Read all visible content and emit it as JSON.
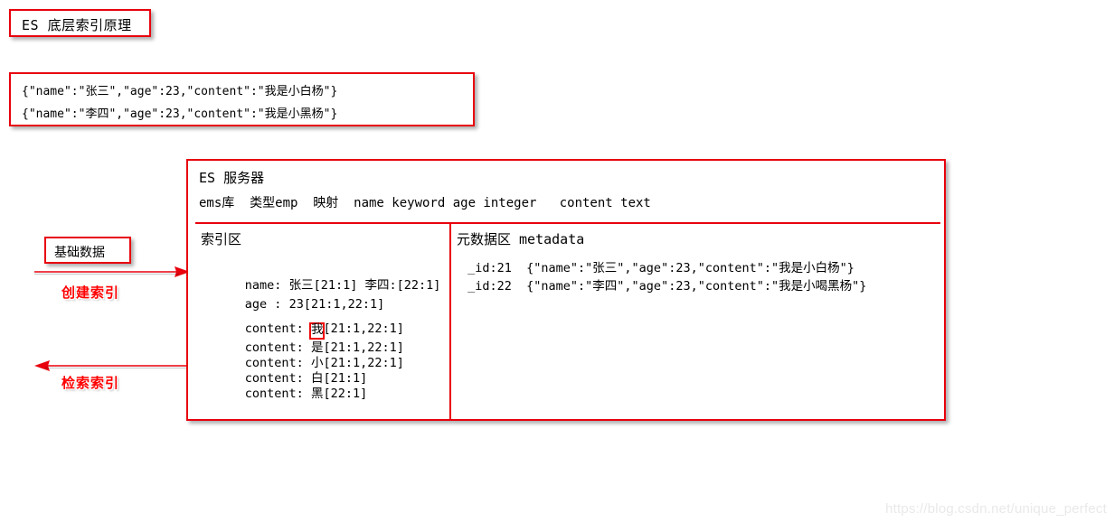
{
  "title": {
    "text": "ES 底层索引原理"
  },
  "source_documents": {
    "lines": [
      "{\"name\":\"张三\",\"age\":23,\"content\":\"我是小白杨\"}",
      "{\"name\":\"李四\",\"age\":23,\"content\":\"我是小黑杨\"}"
    ]
  },
  "annotations": {
    "base_data_label": "基础数据",
    "create_index_label": "创建索引",
    "search_index_label": "检索索引"
  },
  "es_server": {
    "title": "ES 服务器",
    "mapping_line": "ems库  类型emp  映射  name keyword age integer   content text",
    "index_area": {
      "heading": "索引区",
      "rows": [
        {
          "field": "name: ",
          "term": "张三",
          "postings": "[21:1]",
          "extra_term": " 李四:",
          "extra_postings": "[22:1]",
          "highlight": false
        },
        {
          "field": "age : ",
          "term": "23",
          "postings": "[21:1,22:1]",
          "extra_term": "",
          "extra_postings": "",
          "highlight": false
        },
        {
          "field": "content: ",
          "term": "我",
          "postings": "[21:1,22:1]",
          "extra_term": "",
          "extra_postings": "",
          "highlight": true
        },
        {
          "field": "content: ",
          "term": "是",
          "postings": "[21:1,22:1]",
          "extra_term": "",
          "extra_postings": "",
          "highlight": false
        },
        {
          "field": "content: ",
          "term": "小",
          "postings": "[21:1,22:1]",
          "extra_term": "",
          "extra_postings": "",
          "highlight": false
        },
        {
          "field": "content: ",
          "term": "白",
          "postings": "[21:1]",
          "extra_term": "",
          "extra_postings": "",
          "highlight": false
        },
        {
          "field": "content: ",
          "term": "黑",
          "postings": "[22:1]",
          "extra_term": "",
          "extra_postings": "",
          "highlight": false
        }
      ]
    },
    "metadata_area": {
      "heading": "元数据区 metadata",
      "rows": [
        " _id:21  {\"name\":\"张三\",\"age\":23,\"content\":\"我是小白杨\"}",
        " _id:22  {\"name\":\"李四\",\"age\":23,\"content\":\"我是小喝黑杨\"}"
      ]
    }
  },
  "watermark": {
    "text": "https://blog.csdn.net/unique_perfect"
  },
  "colors": {
    "border_red": "#e8000d",
    "label_red": "#ff0000",
    "highlight_red": "#ee0000",
    "text_black": "#000000",
    "background": "#ffffff"
  }
}
